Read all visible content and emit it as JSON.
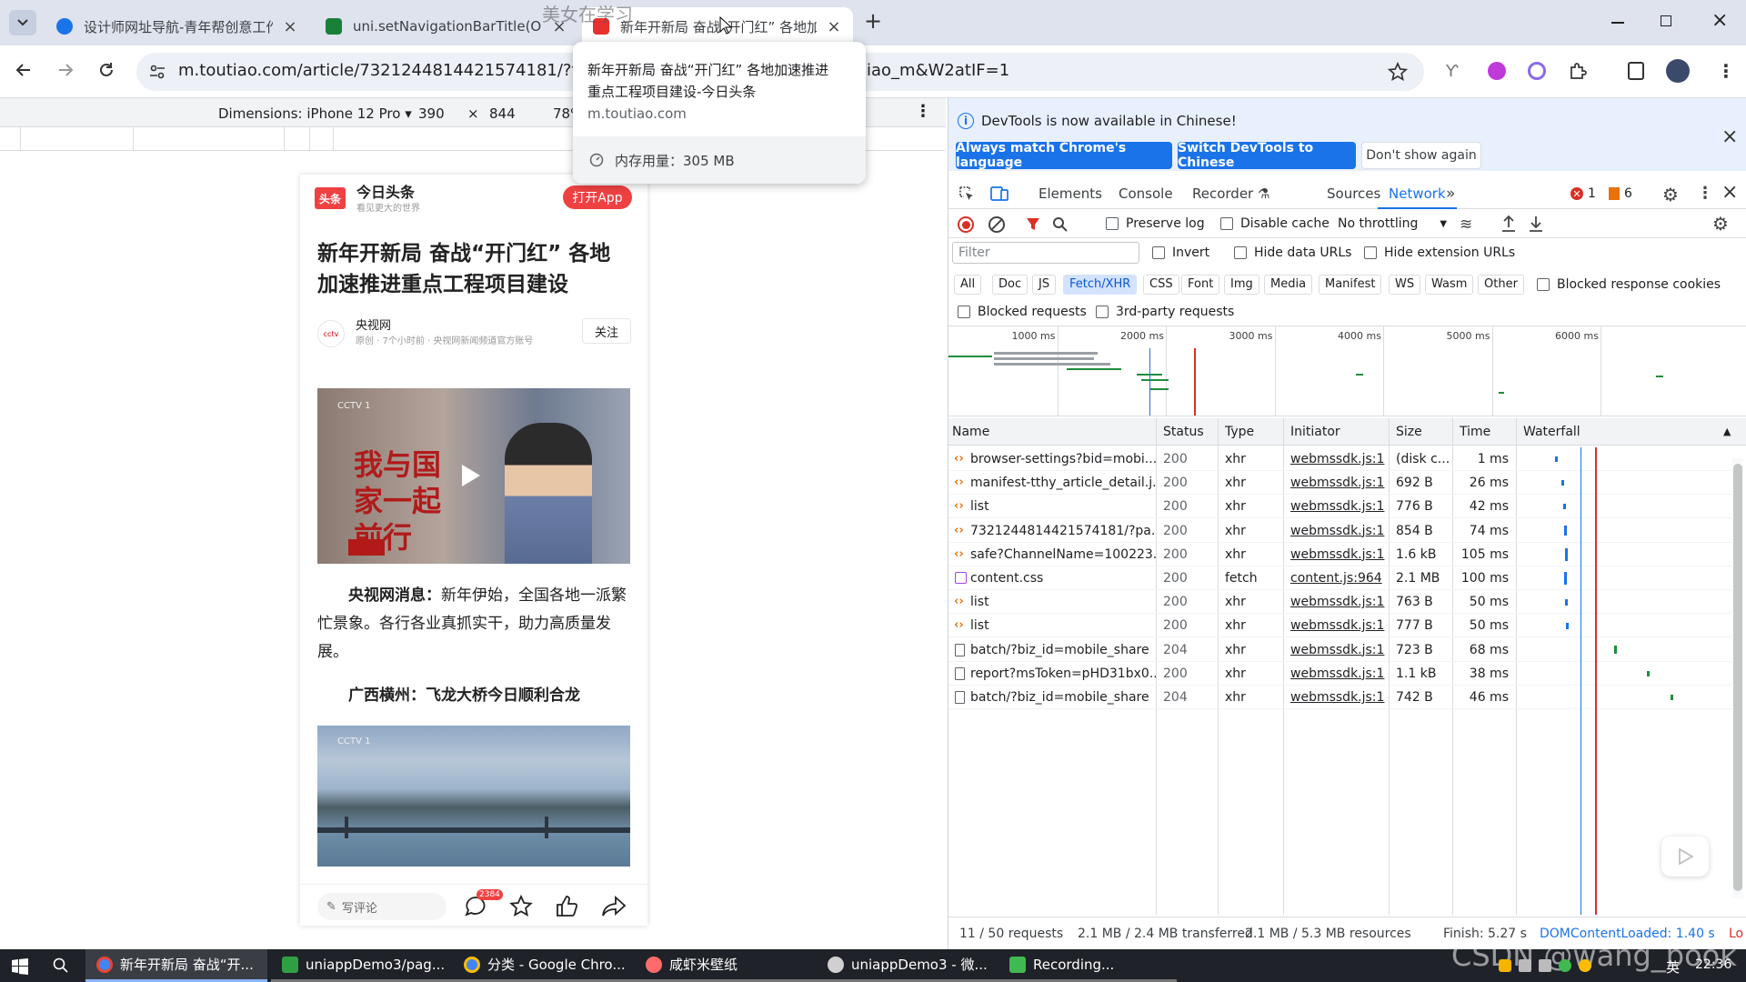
{
  "browser": {
    "tabs": [
      {
        "title": "设计师网址导航-青年帮创意工作",
        "favicon_color": "#1a73e8"
      },
      {
        "title": "uni.setNavigationBarTitle(OBJE",
        "favicon_color": "#188038"
      },
      {
        "title": "新年开新局 奋战“开门红” 各地加速",
        "favicon_color": "#e8312f",
        "active": true
      }
    ],
    "new_tab": "+",
    "watermark_text": "美女在学习",
    "url": "m.toutiao.com/article/7321244814421574181/?from",
    "url_tail": "iao_m&W2atIF=1"
  },
  "tab_tooltip": {
    "title": "新年开新局 奋战“开门红” 各地加速推进重点工程项目建设-今日头条",
    "title_line1": "新年开新局 奋战“开门红” 各地加速推进",
    "title_line2": "重点工程项目建设-今日头条",
    "domain": "m.toutiao.com",
    "memory": "内存用量：305 MB"
  },
  "device_toolbar": {
    "dimensions": "Dimensions: iPhone 12 Pro",
    "width": "390",
    "times": "×",
    "height": "844",
    "zoom": "78%"
  },
  "article": {
    "app_name": "今日头条",
    "app_slogan": "看见更大的世界",
    "logo_text": "头条",
    "open_app": "打开App",
    "headline": "新年开新局 奋战“开门红” 各地加速推进重点工程项目建设",
    "author": "央视网",
    "author_meta": "原创 · 7个小时前 · 央视网新闻频道官方账号",
    "follow": "关注",
    "video_overlay_text": "我与国家一起前行",
    "para1_bold": "央视网消息：",
    "para1_text": "新年伊始，全国各地一派繁忙景象。各行各业真抓实干，助力高质量发展。",
    "subheading": "广西横州：飞龙大桥今日顺利合龙",
    "comment_placeholder": "写评论",
    "comment_count": "2384"
  },
  "devtools": {
    "infobar_text": "DevTools is now available in Chinese!",
    "btn_match": "Always match Chrome's language",
    "btn_switch": "Switch DevTools to Chinese",
    "btn_dont_show": "Don't show again",
    "tabs": [
      "Elements",
      "Console",
      "Recorder",
      "Sources",
      "Network"
    ],
    "active_tab": "Network",
    "error_count": "1",
    "warning_count": "6",
    "preserve_log": "Preserve log",
    "disable_cache": "Disable cache",
    "throttling": "No throttling",
    "filter_placeholder": "Filter",
    "invert": "Invert",
    "hide_data_urls": "Hide data URLs",
    "hide_extension_urls": "Hide extension URLs",
    "type_filters": [
      "All",
      "Doc",
      "JS",
      "Fetch/XHR",
      "CSS",
      "Font",
      "Img",
      "Media",
      "Manifest",
      "WS",
      "Wasm",
      "Other"
    ],
    "selected_type": "Fetch/XHR",
    "blocked_response_cookies": "Blocked response cookies",
    "blocked_requests": "Blocked requests",
    "third_party": "3rd-party requests",
    "timeline_ticks": [
      "1000 ms",
      "2000 ms",
      "3000 ms",
      "4000 ms",
      "5000 ms",
      "6000 ms"
    ],
    "columns": [
      "Name",
      "Status",
      "Type",
      "Initiator",
      "Size",
      "Time",
      "Waterfall"
    ],
    "requests": [
      {
        "name": "browser-settings?bid=mobi...",
        "status": "200",
        "type": "xhr",
        "initiator": "webmssdk.js:1",
        "size": "(disk c...",
        "time": "1 ms",
        "icon": "xhr"
      },
      {
        "name": "manifest-tthy_article_detail.j...",
        "status": "200",
        "type": "xhr",
        "initiator": "webmssdk.js:1",
        "size": "692 B",
        "time": "26 ms",
        "icon": "xhr"
      },
      {
        "name": "list",
        "status": "200",
        "type": "xhr",
        "initiator": "webmssdk.js:1",
        "size": "776 B",
        "time": "42 ms",
        "icon": "xhr"
      },
      {
        "name": "7321244814421574181/?pa...",
        "status": "200",
        "type": "xhr",
        "initiator": "webmssdk.js:1",
        "size": "854 B",
        "time": "74 ms",
        "icon": "xhr"
      },
      {
        "name": "safe?ChannelName=100223...",
        "status": "200",
        "type": "xhr",
        "initiator": "webmssdk.js:1",
        "size": "1.6 kB",
        "time": "105 ms",
        "icon": "xhr"
      },
      {
        "name": "content.css",
        "status": "200",
        "type": "fetch",
        "initiator": "content.js:964",
        "size": "2.1 MB",
        "time": "100 ms",
        "icon": "css"
      },
      {
        "name": "list",
        "status": "200",
        "type": "xhr",
        "initiator": "webmssdk.js:1",
        "size": "763 B",
        "time": "50 ms",
        "icon": "xhr"
      },
      {
        "name": "list",
        "status": "200",
        "type": "xhr",
        "initiator": "webmssdk.js:1",
        "size": "777 B",
        "time": "50 ms",
        "icon": "xhr"
      },
      {
        "name": "batch/?biz_id=mobile_share",
        "status": "204",
        "type": "xhr",
        "initiator": "webmssdk.js:1",
        "size": "723 B",
        "time": "68 ms",
        "icon": "doc"
      },
      {
        "name": "report?msToken=pHD31bx0...",
        "status": "200",
        "type": "xhr",
        "initiator": "webmssdk.js:1",
        "size": "1.1 kB",
        "time": "38 ms",
        "icon": "doc"
      },
      {
        "name": "batch/?biz_id=mobile_share",
        "status": "204",
        "type": "xhr",
        "initiator": "webmssdk.js:1",
        "size": "742 B",
        "time": "46 ms",
        "icon": "doc"
      }
    ],
    "status_requests": "11 / 50 requests",
    "status_transferred": "2.1 MB / 2.4 MB transferred",
    "status_resources": "2.1 MB / 5.3 MB resources",
    "status_finish": "Finish: 5.27 s",
    "status_dcl": "DOMContentLoaded: 1.40 s",
    "status_load": "Lo"
  },
  "taskbar": {
    "items": [
      {
        "label": "新年开新局 奋战“开...",
        "color": "#4285f4",
        "active": true
      },
      {
        "label": "uniappDemo3/pag...",
        "color": "#2ea043"
      },
      {
        "label": "分类 - Google Chro...",
        "color": "#4285f4"
      },
      {
        "label": "咸虾米壁纸",
        "color": "#ff6b6b"
      },
      {
        "label": "uniappDemo3 - 微...",
        "color": "#d0d0d0"
      },
      {
        "label": "Recording...",
        "color": "#3fb950"
      }
    ],
    "ime": "英",
    "clock": "22:36",
    "watermark": "CSDN @wang_book"
  },
  "colors": {
    "accent_blue": "#1a73e8",
    "toutiao_red": "#f04142",
    "error_red": "#d93025",
    "warning_orange": "#e8710a"
  }
}
